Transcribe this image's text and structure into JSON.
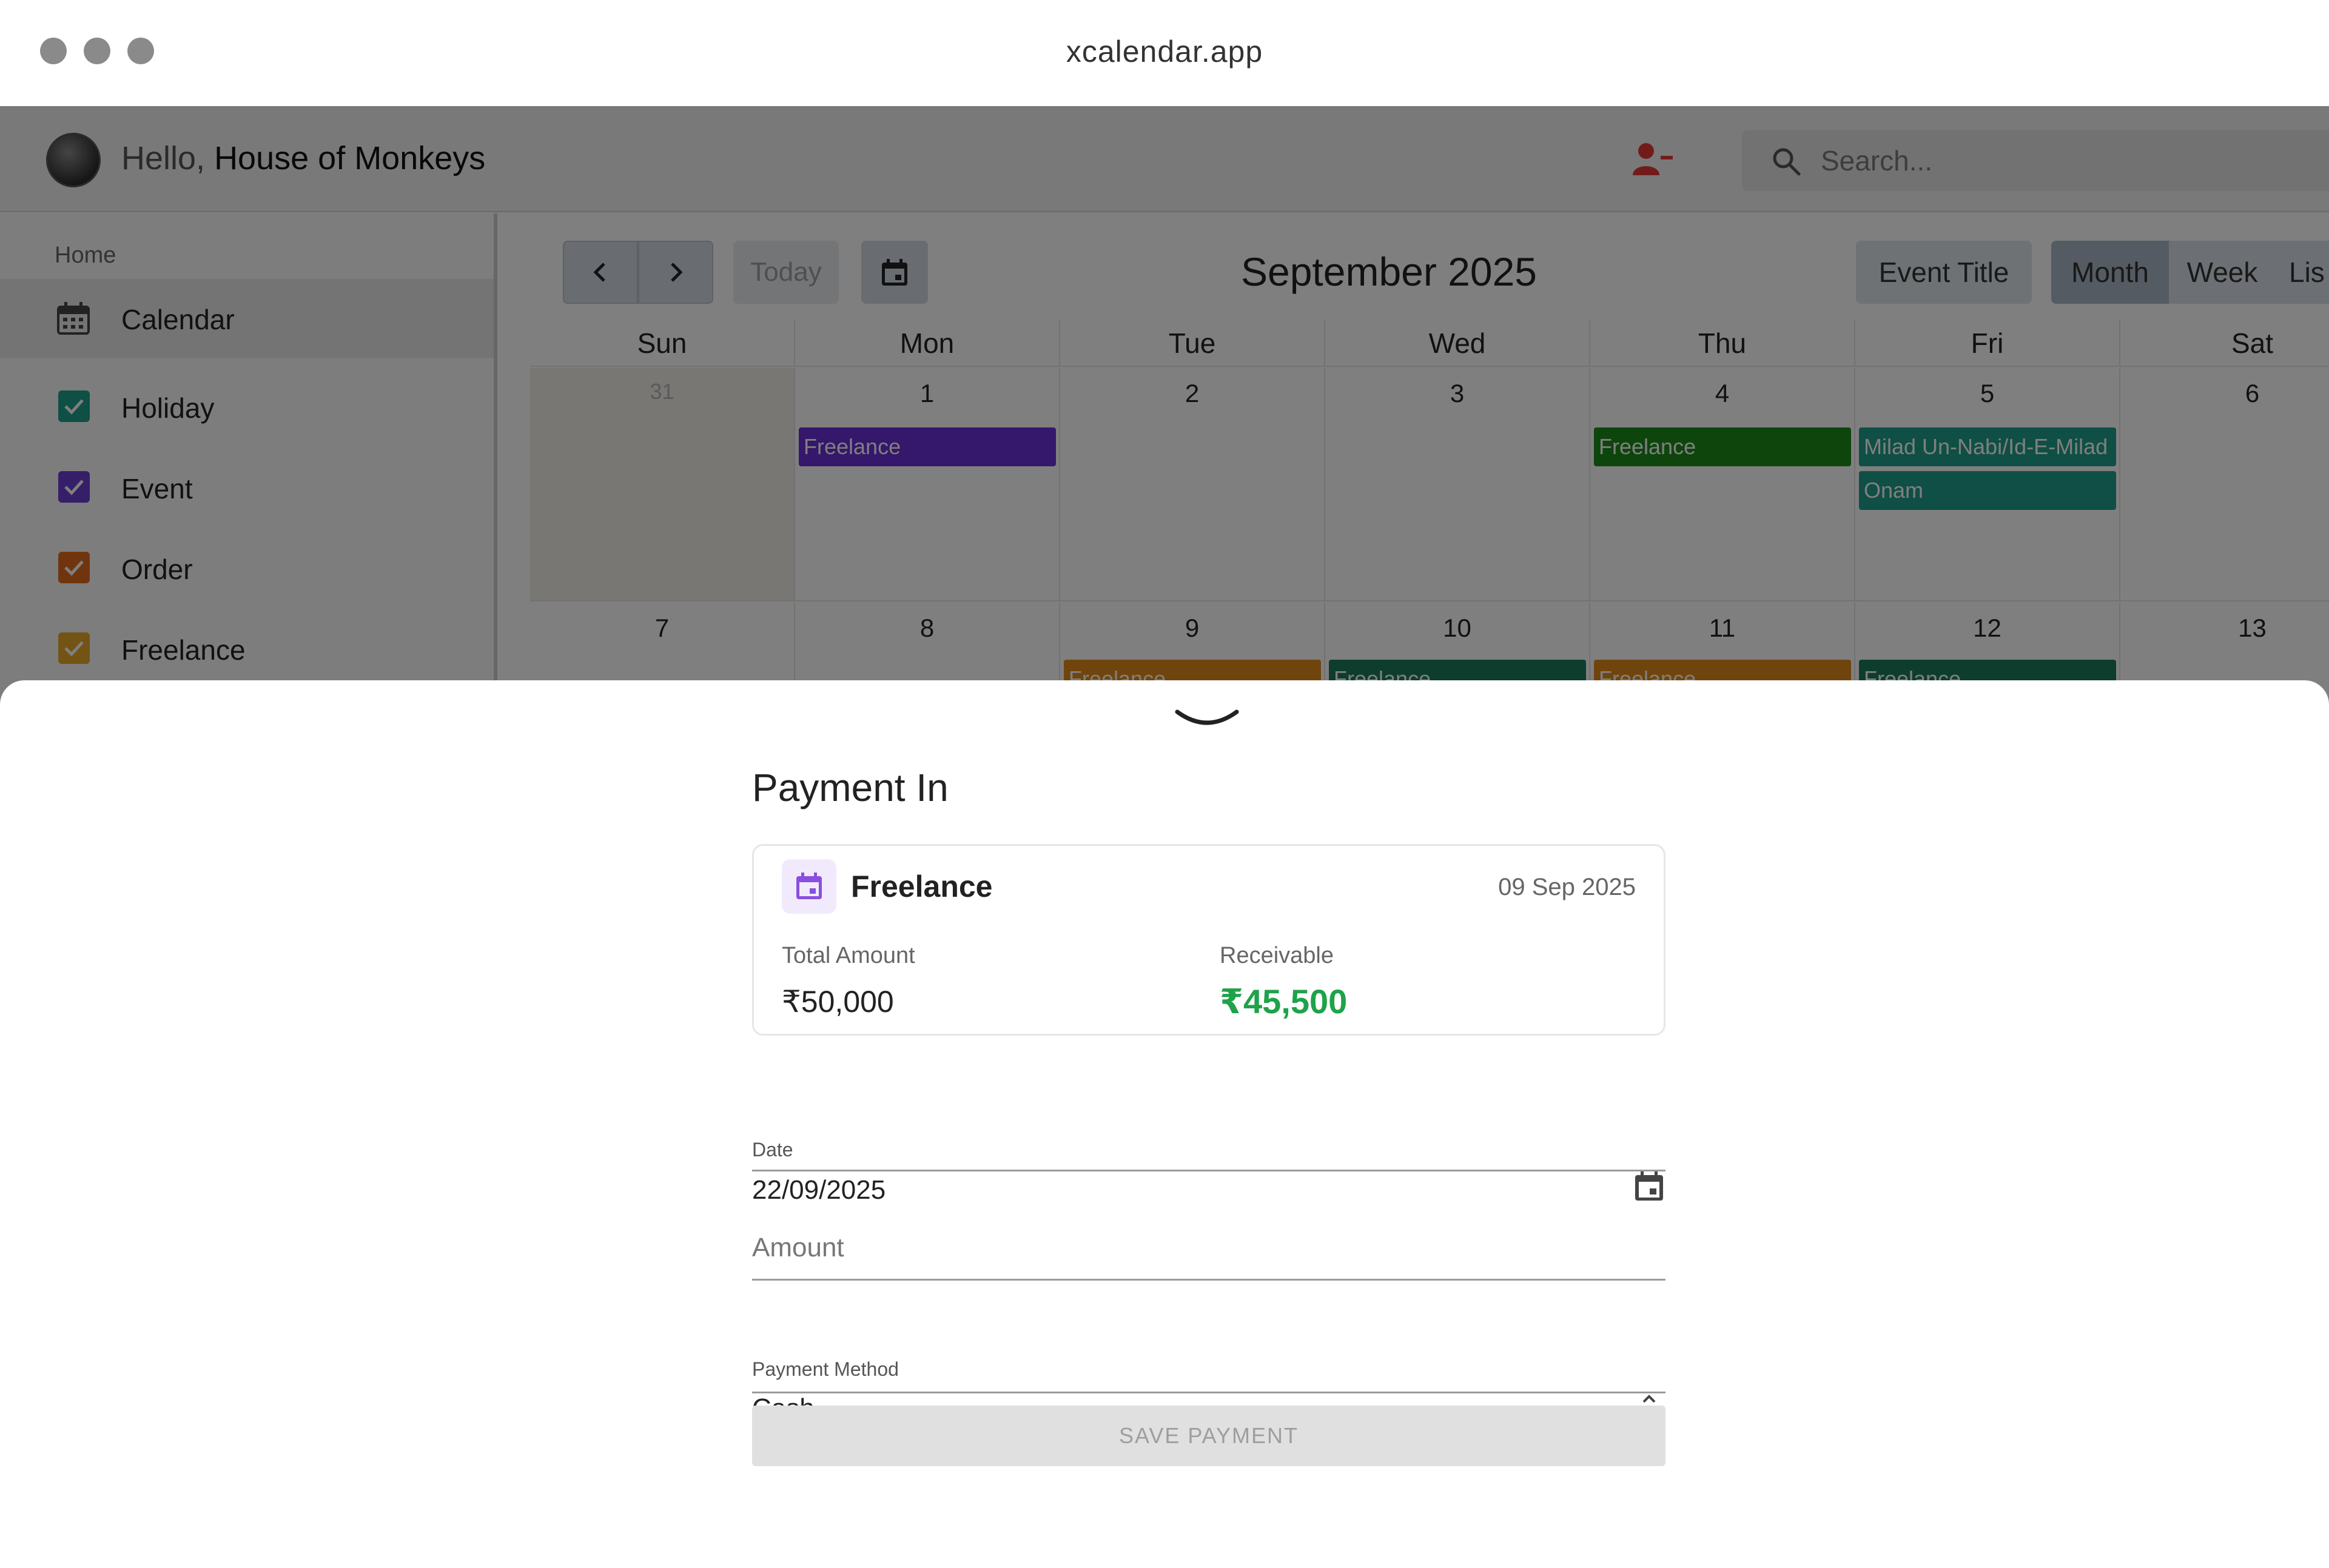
{
  "window": {
    "title": "xcalendar.app"
  },
  "header": {
    "greeting_prefix": "Hello, ",
    "user_name": "House of Monkeys",
    "search_placeholder": "Search..."
  },
  "sidebar": {
    "section": "Home",
    "nav_label": "Calendar",
    "filters": [
      {
        "label": "Holiday",
        "color": "#1f9e8a",
        "checked": true
      },
      {
        "label": "Event",
        "color": "#6a3fd0",
        "checked": true
      },
      {
        "label": "Order",
        "color": "#e06a1c",
        "checked": true
      },
      {
        "label": "Freelance",
        "color": "#e7a82a",
        "checked": true
      }
    ]
  },
  "calendar": {
    "today_label": "Today",
    "month_title": "September 2025",
    "event_title_label": "Event Title",
    "views": [
      "Month",
      "Week",
      "Lis"
    ],
    "weekdays": [
      "Sun",
      "Mon",
      "Tue",
      "Wed",
      "Thu",
      "Fri",
      "Sat"
    ],
    "week1": [
      "31",
      "1",
      "2",
      "3",
      "4",
      "5",
      "6"
    ],
    "week2": [
      "7",
      "8",
      "9",
      "10",
      "11",
      "12",
      "13"
    ],
    "events": [
      {
        "title": "Freelance",
        "color": "#6a2fd6"
      },
      {
        "title": "Freelance",
        "color": "#1a8a1a"
      },
      {
        "title": "Milad Un-Nabi/Id-E-Milad",
        "color": "#1f9e8a"
      },
      {
        "title": "Onam",
        "color": "#1f9e8a"
      },
      {
        "title": "Freelance",
        "color": "#e08a1a"
      },
      {
        "title": "Freelance",
        "color": "#1d7a5a"
      },
      {
        "title": "Freelance",
        "color": "#e08a1a"
      },
      {
        "title": "Freelance",
        "color": "#1d7a5a"
      }
    ]
  },
  "sheet": {
    "title": "Payment In",
    "card": {
      "name": "Freelance",
      "date": "09 Sep 2025",
      "total_label": "Total Amount",
      "total_value": "₹50,000",
      "receivable_label": "Receivable",
      "receivable_value": "₹45,500"
    },
    "date_field": {
      "label": "Date",
      "value": "22/09/2025"
    },
    "amount_field": {
      "placeholder": "Amount"
    },
    "method_field": {
      "label": "Payment Method",
      "value": "Cash"
    },
    "save_label": "SAVE PAYMENT"
  }
}
